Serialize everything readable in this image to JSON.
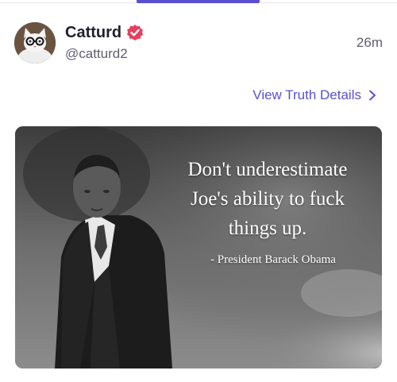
{
  "post": {
    "author": {
      "display_name": "Catturd",
      "handle": "@catturd2",
      "verified": true,
      "avatar_icon": "cat-with-glasses-avatar"
    },
    "timestamp": "26m",
    "details_link": "View Truth Details",
    "media": {
      "quote_lines": [
        "Don't underestimate",
        "Joe's ability to fuck",
        "things up."
      ],
      "attribution": "- President Barack Obama"
    }
  },
  "colors": {
    "accent": "#5b4fcf",
    "verified_badge": "#e4405f",
    "text_primary": "#1f1f2e",
    "text_secondary": "#5e5e6e"
  },
  "icons": {
    "verified": "verified-badge-icon",
    "chevron": "chevron-right-icon"
  }
}
